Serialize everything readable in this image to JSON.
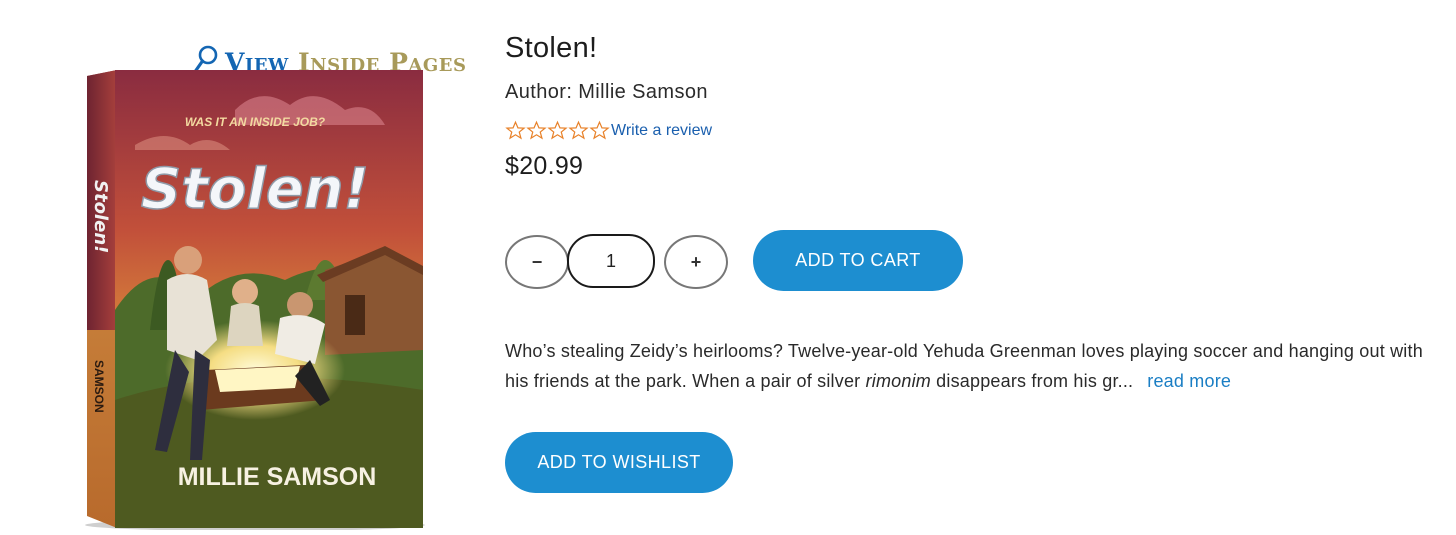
{
  "view_inside": {
    "view": "View",
    "inside": "Inside Pages",
    "icon": "magnifier-icon"
  },
  "book_cover": {
    "tagline": "WAS IT AN INSIDE JOB?",
    "title": "Stolen!",
    "spine_title": "Stolen!",
    "spine_author": "SAMSON",
    "author": "MILLIE SAMSON"
  },
  "product": {
    "title": "Stolen!",
    "author": "Author: Millie Samson",
    "rating": {
      "stars": 0,
      "max": 5,
      "review_link": "Write a review"
    },
    "price": "$20.99"
  },
  "quantity": {
    "minus": "−",
    "value": "1",
    "plus": "+"
  },
  "buttons": {
    "add_to_cart": "ADD TO CART",
    "add_to_wishlist": "ADD TO WISHLIST"
  },
  "description": {
    "before_italic": "Who’s stealing Zeidy’s heirlooms? Twelve-year-old Yehuda Greenman loves playing soccer and hanging out with his friends at the park. When a pair of silver ",
    "italic": "rimonim",
    "after_italic": " disappears from his gr...",
    "read_more": "read more"
  },
  "colors": {
    "accent": "#1d8ed0",
    "link": "#1a5fae",
    "star_outline": "#e8822a",
    "view_blue": "#1466b3",
    "inside_gold": "#a89a5a"
  }
}
